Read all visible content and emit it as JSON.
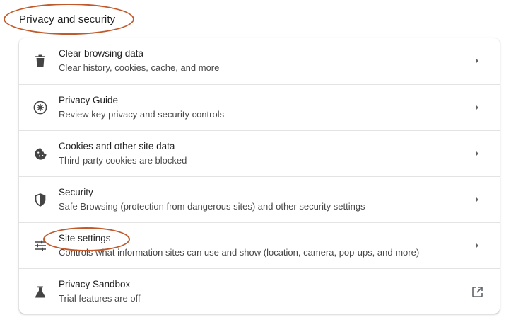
{
  "section": {
    "title": "Privacy and security"
  },
  "annotation_color": "#c05a2b",
  "rows": [
    {
      "title": "Clear browsing data",
      "subtitle": "Clear history, cookies, cache, and more",
      "icon": "trash-icon",
      "action": "chevron-right-icon"
    },
    {
      "title": "Privacy Guide",
      "subtitle": "Review key privacy and security controls",
      "icon": "compass-icon",
      "action": "chevron-right-icon"
    },
    {
      "title": "Cookies and other site data",
      "subtitle": "Third-party cookies are blocked",
      "icon": "cookie-icon",
      "action": "chevron-right-icon"
    },
    {
      "title": "Security",
      "subtitle": "Safe Browsing (protection from dangerous sites) and other security settings",
      "icon": "shield-icon",
      "action": "chevron-right-icon"
    },
    {
      "title": "Site settings",
      "subtitle": "Controls what information sites can use and show (location, camera, pop-ups, and more)",
      "icon": "sliders-icon",
      "action": "chevron-right-icon"
    },
    {
      "title": "Privacy Sandbox",
      "subtitle": "Trial features are off",
      "icon": "flask-icon",
      "action": "external-link-icon"
    }
  ]
}
